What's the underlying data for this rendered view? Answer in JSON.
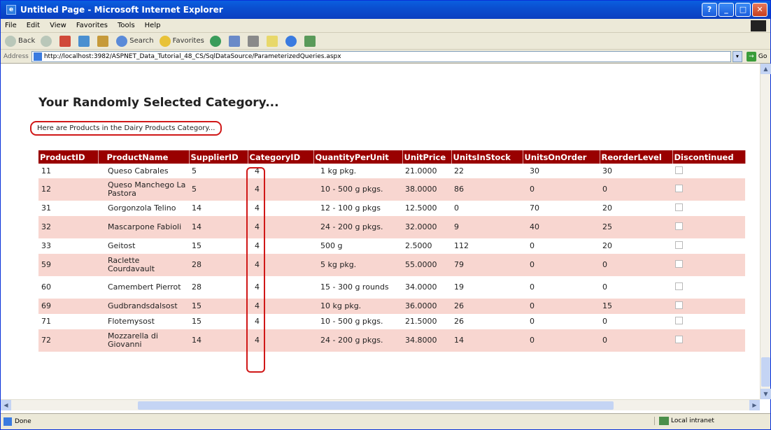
{
  "window": {
    "title": "Untitled Page - Microsoft Internet Explorer"
  },
  "menu": [
    "File",
    "Edit",
    "View",
    "Favorites",
    "Tools",
    "Help"
  ],
  "toolbar": {
    "back": "Back",
    "search": "Search",
    "favorites": "Favorites"
  },
  "address": {
    "label": "Address",
    "url": "http://localhost:3982/ASPNET_Data_Tutorial_48_CS/SqlDataSource/ParameterizedQueries.aspx",
    "go": "Go"
  },
  "page": {
    "heading": "Your Randomly Selected Category...",
    "category_label": "Here are Products in the Dairy Products Category..."
  },
  "grid": {
    "columns": [
      "ProductID",
      "ProductName",
      "SupplierID",
      "CategoryID",
      "QuantityPerUnit",
      "UnitPrice",
      "UnitsInStock",
      "UnitsOnOrder",
      "ReorderLevel",
      "Discontinued"
    ],
    "rows": [
      [
        "11",
        "Queso Cabrales",
        "5",
        "4",
        "1 kg pkg.",
        "21.0000",
        "22",
        "30",
        "30"
      ],
      [
        "12",
        "Queso Manchego La Pastora",
        "5",
        "4",
        "10 - 500 g pkgs.",
        "38.0000",
        "86",
        "0",
        "0"
      ],
      [
        "31",
        "Gorgonzola Telino",
        "14",
        "4",
        "12 - 100 g pkgs",
        "12.5000",
        "0",
        "70",
        "20"
      ],
      [
        "32",
        "Mascarpone Fabioli",
        "14",
        "4",
        "24 - 200 g pkgs.",
        "32.0000",
        "9",
        "40",
        "25"
      ],
      [
        "33",
        "Geitost",
        "15",
        "4",
        "500 g",
        "2.5000",
        "112",
        "0",
        "20"
      ],
      [
        "59",
        "Raclette Courdavault",
        "28",
        "4",
        "5 kg pkg.",
        "55.0000",
        "79",
        "0",
        "0"
      ],
      [
        "60",
        "Camembert Pierrot",
        "28",
        "4",
        "15 - 300 g rounds",
        "34.0000",
        "19",
        "0",
        "0"
      ],
      [
        "69",
        "Gudbrandsdalsost",
        "15",
        "4",
        "10 kg pkg.",
        "36.0000",
        "26",
        "0",
        "15"
      ],
      [
        "71",
        "Flotemysost",
        "15",
        "4",
        "10 - 500 g pkgs.",
        "21.5000",
        "26",
        "0",
        "0"
      ],
      [
        "72",
        "Mozzarella di Giovanni",
        "14",
        "4",
        "24 - 200 g pkgs.",
        "34.8000",
        "14",
        "0",
        "0"
      ]
    ]
  },
  "status": {
    "text": "Done",
    "zone": "Local intranet"
  },
  "colors": {
    "header_bg": "#990000",
    "alt_row_bg": "#f8d6d0",
    "highlight": "#d01818"
  }
}
